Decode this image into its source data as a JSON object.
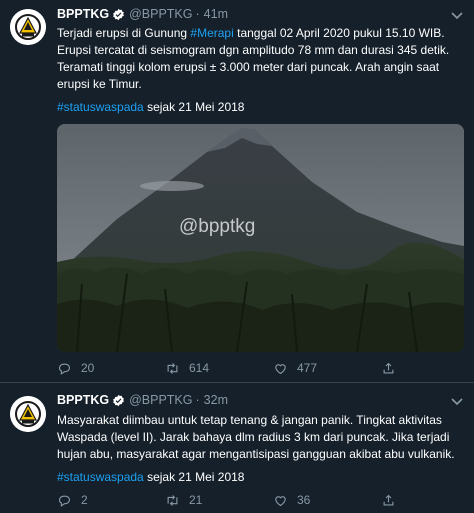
{
  "tweets": [
    {
      "author": {
        "name": "BPPTKG",
        "handle": "@BPPTKG"
      },
      "time": "41m",
      "text": {
        "t1": "Terjadi erupsi di Gunung ",
        "tag1": "#Merapi",
        "t2": " tanggal 02 April 2020 pukul 15.10 WIB. Erupsi tercatat di seismogram dgn amplitudo 78 mm dan durasi  345 detik. Teramati tinggi kolom erupsi ± 3.000 meter dari puncak. Arah angin saat erupsi ke Timur.",
        "tag2": "#statuswaspada",
        "t3": " sejak 21 Mei 2018"
      },
      "media_watermark": "@bpptkg",
      "stats": {
        "replies": "20",
        "retweets": "614",
        "likes": "477"
      }
    },
    {
      "author": {
        "name": "BPPTKG",
        "handle": "@BPPTKG"
      },
      "time": "32m",
      "text": {
        "t1": "Masyarakat diimbau untuk tetap tenang & jangan panik. Tingkat aktivitas Waspada (level II). Jarak bahaya dlm radius 3 km dari puncak. Jika terjadi hujan abu, masyarakat agar mengantisipasi gangguan akibat abu vulkanik.",
        "tag1": "#statuswaspada",
        "t2": " sejak 21 Mei 2018"
      },
      "stats": {
        "replies": "2",
        "retweets": "21",
        "likes": "36"
      }
    }
  ],
  "colors": {
    "background": "#15202b",
    "accent": "#1da1f2",
    "muted": "#8899a6",
    "divider": "#38444d"
  },
  "icons": [
    "avatar-logo",
    "verified-badge-icon",
    "chevron-down-icon",
    "reply-icon",
    "retweet-icon",
    "like-icon",
    "share-icon"
  ]
}
